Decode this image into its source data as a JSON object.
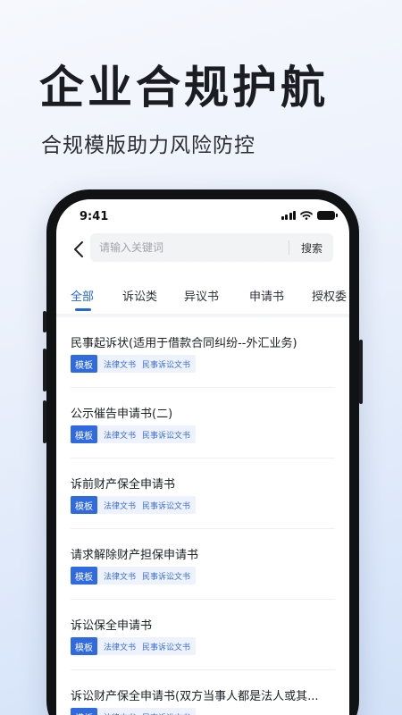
{
  "promo": {
    "title": "企业合规护航",
    "subtitle": "合规模版助力风险防控"
  },
  "status_bar": {
    "time": "9:41"
  },
  "search": {
    "placeholder": "请输入关键词",
    "button_label": "搜索"
  },
  "tabs": [
    {
      "label": "全部",
      "active": true
    },
    {
      "label": "诉讼类",
      "active": false
    },
    {
      "label": "异议书",
      "active": false
    },
    {
      "label": "申请书",
      "active": false
    },
    {
      "label": "授权委",
      "active": false
    }
  ],
  "documents": [
    {
      "title": "民事起诉状(适用于借款合同纠纷--外汇业务)",
      "tag": "模板",
      "cat1": "法律文书",
      "cat2": "民事诉讼文书"
    },
    {
      "title": "公示催告申请书(二)",
      "tag": "模板",
      "cat1": "法律文书",
      "cat2": "民事诉讼文书"
    },
    {
      "title": "诉前财产保全申请书",
      "tag": "模板",
      "cat1": "法律文书",
      "cat2": "民事诉讼文书"
    },
    {
      "title": "请求解除财产担保申请书",
      "tag": "模板",
      "cat1": "法律文书",
      "cat2": "民事诉讼文书"
    },
    {
      "title": "诉讼保全申请书",
      "tag": "模板",
      "cat1": "法律文书",
      "cat2": "民事诉讼文书"
    },
    {
      "title": "诉讼财产保全申请书(双方当事人都是法人或其...",
      "tag": "模板",
      "cat1": "法律文书",
      "cat2": "民事诉讼文书"
    }
  ],
  "colors": {
    "accent": "#2466dc",
    "tag_bg": "#2f6ae0",
    "tag_light_bg": "#eef2fd"
  }
}
